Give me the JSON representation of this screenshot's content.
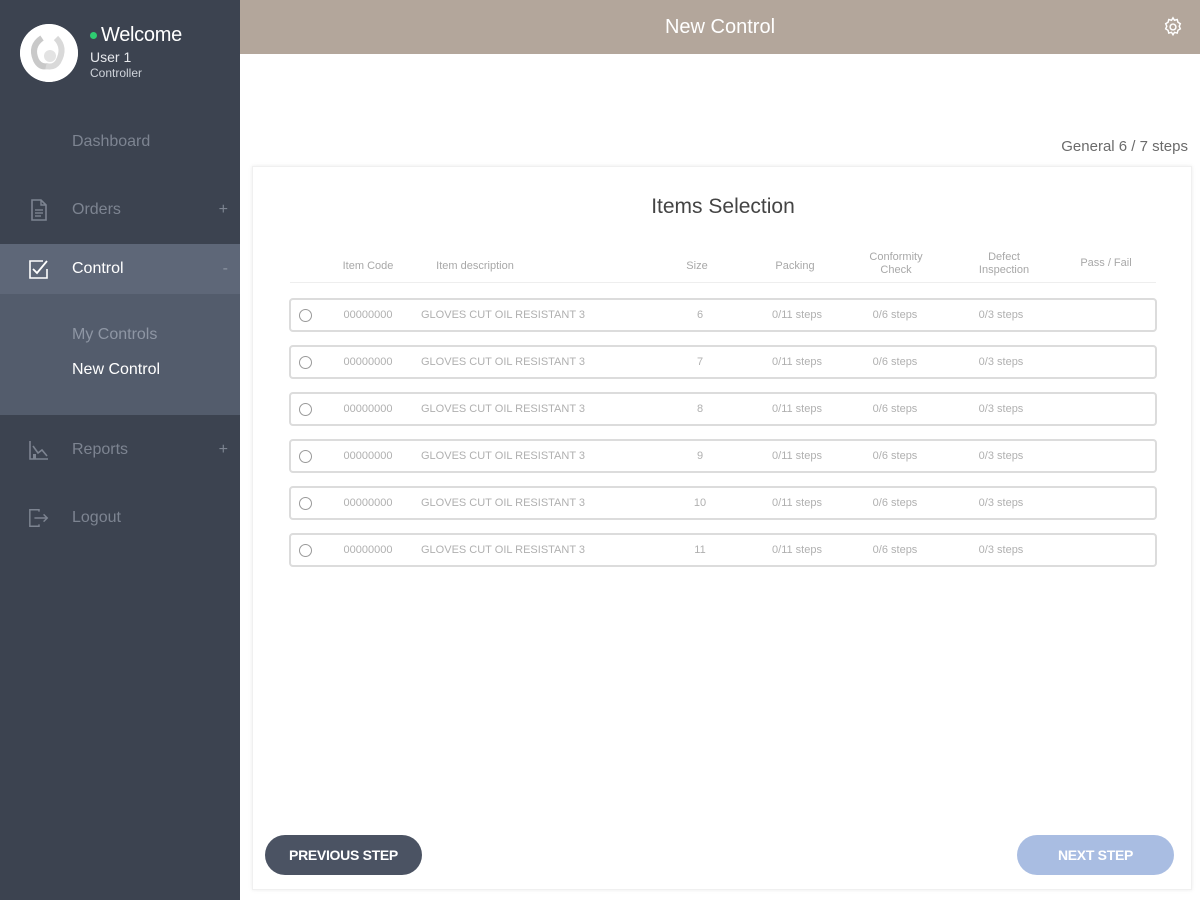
{
  "profile": {
    "welcome": "Welcome",
    "user_name": "User 1",
    "user_role": "Controller",
    "status_color": "#2ecc71"
  },
  "sidebar": {
    "items": [
      {
        "label": "Dashboard"
      },
      {
        "label": "Orders",
        "icon": "document-icon",
        "expand": "+"
      },
      {
        "label": "Control",
        "icon": "checkbox-icon",
        "expand": "-"
      },
      {
        "label": "Reports",
        "icon": "chart-icon",
        "expand": "+"
      },
      {
        "label": "Logout",
        "icon": "logout-icon"
      }
    ],
    "control_sub": [
      {
        "label": "My Controls"
      },
      {
        "label": "New Control"
      }
    ]
  },
  "header": {
    "title": "New Control",
    "settings_icon": "gear-icon"
  },
  "progress": {
    "text": "General 6 / 7 steps"
  },
  "card": {
    "title": "Items Selection"
  },
  "table": {
    "columns": [
      "Item Code",
      "Item description",
      "Size",
      "Packing",
      "Conformity Check",
      "Defect Inspection",
      "Pass / Fail"
    ],
    "rows": [
      {
        "code": "00000000",
        "description": "GLOVES CUT OIL RESISTANT 3",
        "size": "6",
        "packing": "0/11 steps",
        "conformity": "0/6 steps",
        "defect": "0/3 steps"
      },
      {
        "code": "00000000",
        "description": "GLOVES CUT OIL RESISTANT 3",
        "size": "7",
        "packing": "0/11 steps",
        "conformity": "0/6 steps",
        "defect": "0/3 steps"
      },
      {
        "code": "00000000",
        "description": "GLOVES CUT OIL RESISTANT 3",
        "size": "8",
        "packing": "0/11 steps",
        "conformity": "0/6 steps",
        "defect": "0/3 steps"
      },
      {
        "code": "00000000",
        "description": "GLOVES CUT OIL RESISTANT 3",
        "size": "9",
        "packing": "0/11 steps",
        "conformity": "0/6 steps",
        "defect": "0/3 steps"
      },
      {
        "code": "00000000",
        "description": "GLOVES CUT OIL RESISTANT 3",
        "size": "10",
        "packing": "0/11 steps",
        "conformity": "0/6 steps",
        "defect": "0/3 steps"
      },
      {
        "code": "00000000",
        "description": "GLOVES CUT OIL RESISTANT 3",
        "size": "11",
        "packing": "0/11 steps",
        "conformity": "0/6 steps",
        "defect": "0/3 steps"
      }
    ]
  },
  "buttons": {
    "previous": "PREVIOUS STEP",
    "next": "NEXT STEP"
  }
}
